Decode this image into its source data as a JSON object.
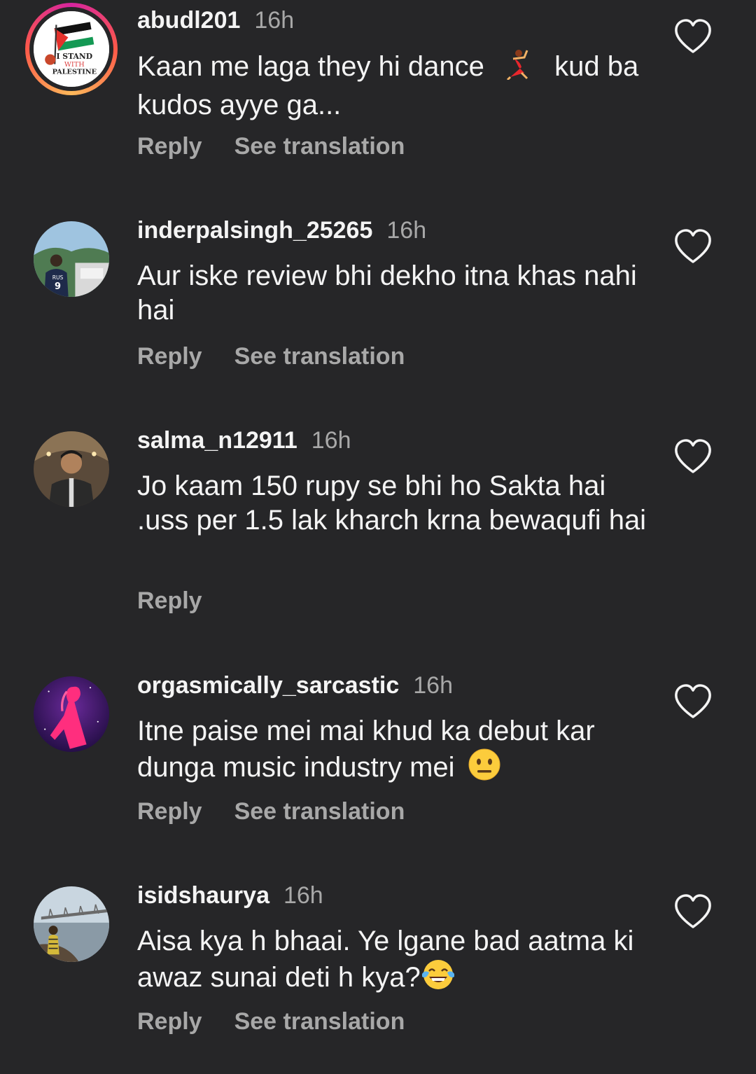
{
  "comments": [
    {
      "username": "abudl201",
      "time": "16h",
      "text": "Kaan me laga they hi dance",
      "emoji": "dancer",
      "text_after": "kud ba kudos ayye ga...",
      "reply": "Reply",
      "translate": "See translation",
      "avatar_text": [
        "I STAND",
        "WITH",
        "PALESTINE"
      ]
    },
    {
      "username": "inderpalsingh_25265",
      "time": "16h",
      "text": "Aur iske review bhi dekho itna khas nahi hai",
      "reply": "Reply",
      "translate": "See translation",
      "avatar_text": [
        "RUS",
        "9"
      ]
    },
    {
      "username": "salma_n12911",
      "time": "16h",
      "text": "Jo kaam 150 rupy se bhi ho Sakta hai .uss per 1.5 lak kharch krna bewaqufi hai",
      "reply": "Reply"
    },
    {
      "username": "orgasmically_sarcastic",
      "time": "16h",
      "text": "Itne paise mei mai khud ka debut kar dunga music industry mei",
      "emoji": "neutral-face",
      "reply": "Reply",
      "translate": "See translation"
    },
    {
      "username": "isidshaurya",
      "time": "16h",
      "text": "Aisa kya h bhaai. Ye lgane bad aatma ki awaz sunai deti h kya?",
      "emoji": "tears-of-joy",
      "reply": "Reply",
      "translate": "See translation"
    }
  ],
  "colors": {
    "background": "#262628",
    "text": "#f4f4f4",
    "secondary": "#a8a8a8",
    "story_ring": "#d6249f"
  },
  "icons": {
    "like": "heart-outline-icon"
  }
}
